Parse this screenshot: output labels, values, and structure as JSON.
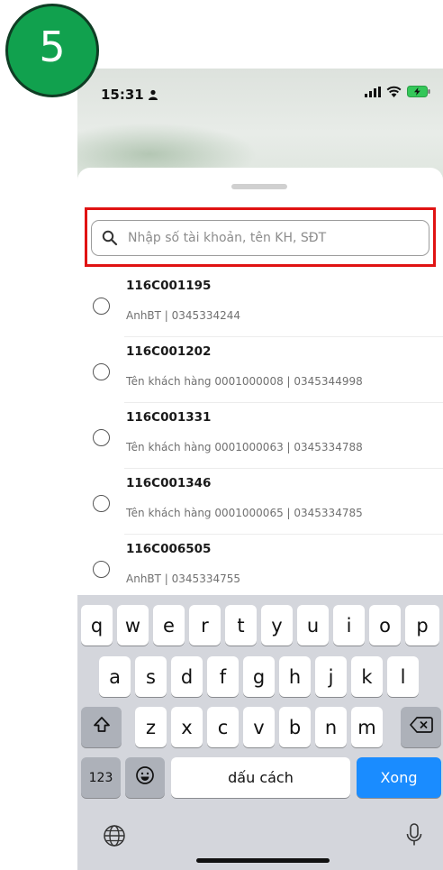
{
  "step_badge": "5",
  "status_bar": {
    "time": "15:31",
    "person_icon": "person-icon",
    "signal_icon": "signal-bars-icon",
    "wifi_icon": "wifi-icon",
    "battery_icon": "battery-charging-icon"
  },
  "search": {
    "placeholder": "Nhập số tài khoản, tên KH, SĐT",
    "icon": "search-icon",
    "highlight_color": "#e01313"
  },
  "accounts": [
    {
      "code": "116C001195",
      "detail": "AnhBT | 0345334244"
    },
    {
      "code": "116C001202",
      "detail": "Tên khách hàng 0001000008 | 0345344998"
    },
    {
      "code": "116C001331",
      "detail": "Tên khách hàng 0001000063 | 0345334788"
    },
    {
      "code": "116C001346",
      "detail": "Tên khách hàng 0001000065 | 0345334785"
    },
    {
      "code": "116C006505",
      "detail": "AnhBT | 0345334755"
    }
  ],
  "keyboard": {
    "row1": [
      "q",
      "w",
      "e",
      "r",
      "t",
      "y",
      "u",
      "i",
      "o",
      "p"
    ],
    "row2": [
      "a",
      "s",
      "d",
      "f",
      "g",
      "h",
      "j",
      "k",
      "l"
    ],
    "row3": [
      "z",
      "x",
      "c",
      "v",
      "b",
      "n",
      "m"
    ],
    "numbers_key": "123",
    "space_key": "dấu cách",
    "done_key": "Xong",
    "shift_icon": "shift-icon",
    "backspace_icon": "backspace-icon",
    "emoji_icon": "emoji-icon",
    "globe_icon": "globe-icon",
    "mic_icon": "microphone-icon"
  },
  "colors": {
    "badge": "#11a14e",
    "accent_blue": "#1a8cff"
  }
}
